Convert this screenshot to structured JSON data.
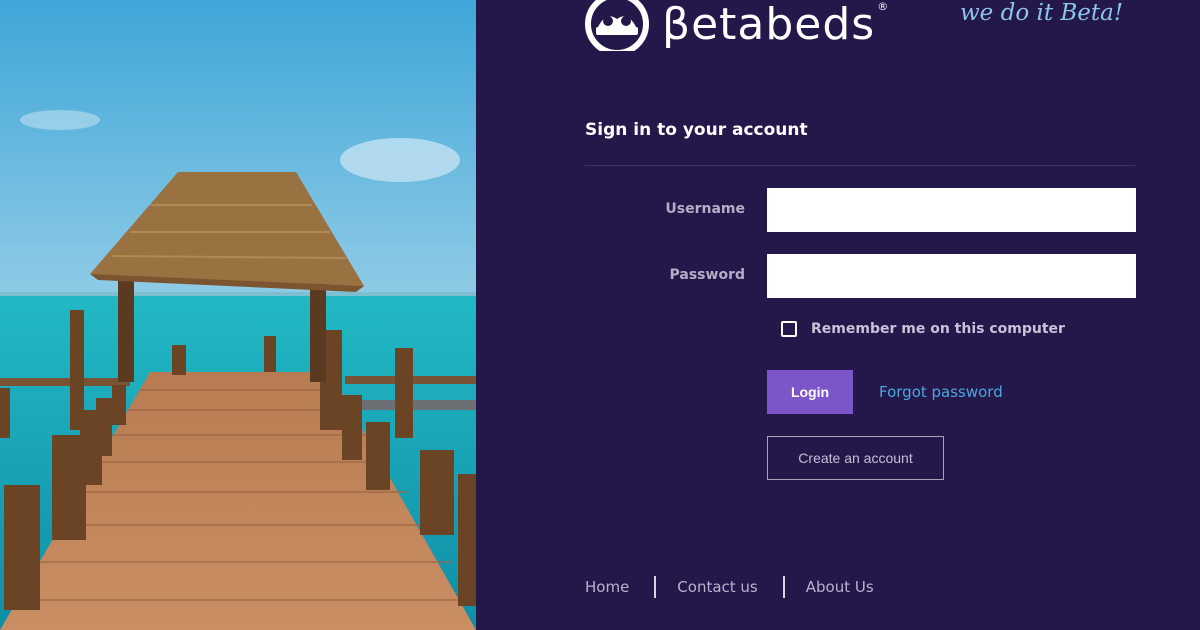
{
  "brand": {
    "name": "βetabeds",
    "registered": "®",
    "tagline": "we do it Beta!"
  },
  "form": {
    "heading": "Sign in to your account",
    "username_label": "Username",
    "username_value": "",
    "password_label": "Password",
    "password_value": "",
    "remember_label": "Remember me on this computer",
    "remember_checked": false,
    "login_label": "Login",
    "forgot_label": "Forgot password",
    "create_label": "Create an account"
  },
  "footer": {
    "links": [
      "Home",
      "Contact us",
      "About Us"
    ]
  },
  "colors": {
    "panel_bg": "#24174a",
    "login_button": "#7a56c9",
    "link": "#4ba7df",
    "tagline": "#8cc4ea"
  },
  "icons": {
    "logo": "bed-circle-logo-icon",
    "checkbox": "checkbox-icon"
  }
}
